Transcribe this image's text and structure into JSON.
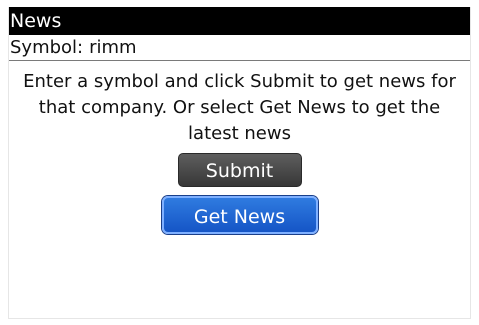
{
  "window": {
    "title": "News"
  },
  "symbol_field": {
    "label": "Symbol:",
    "value": "rimm"
  },
  "instructions": "Enter a symbol and click Submit to get news for that company.  Or select Get News to get the latest news",
  "buttons": {
    "submit_label": "Submit",
    "get_news_label": "Get News"
  },
  "colors": {
    "title_bar_bg": "#000000",
    "submit_bg": "#474747",
    "get_news_bg": "#1e63d4"
  }
}
